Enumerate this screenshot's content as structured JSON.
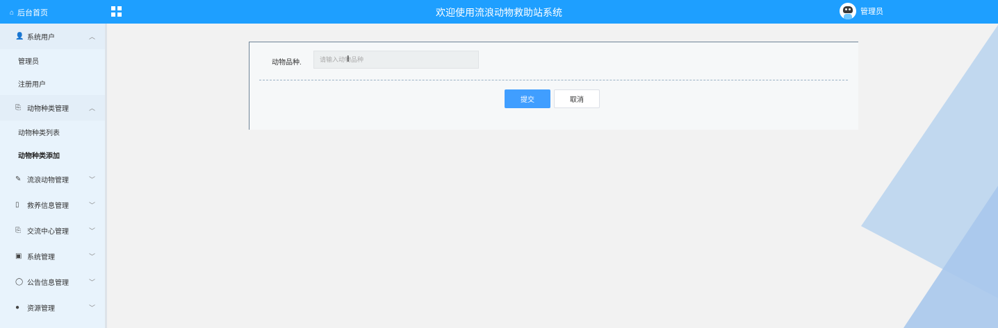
{
  "topbar": {
    "home_label": "后台首页",
    "title": "欢迎使用流浪动物救助站系统",
    "username": "管理员"
  },
  "sidebar": {
    "groups": [
      {
        "label": "系统用户",
        "icon": "user-icon",
        "expanded": true,
        "children": [
          {
            "label": "管理员"
          },
          {
            "label": "注册用户"
          }
        ]
      },
      {
        "label": "动物种类管理",
        "icon": "folder-icon",
        "expanded": true,
        "children": [
          {
            "label": "动物种类列表"
          },
          {
            "label": "动物种类添加",
            "active": true
          }
        ]
      },
      {
        "label": "流浪动物管理",
        "icon": "edit-icon",
        "expanded": false
      },
      {
        "label": "救养信息管理",
        "icon": "document-icon",
        "expanded": false
      },
      {
        "label": "交流中心管理",
        "icon": "folder-icon",
        "expanded": false
      },
      {
        "label": "系统管理",
        "icon": "image-icon",
        "expanded": false
      },
      {
        "label": "公告信息管理",
        "icon": "circle-icon",
        "expanded": false
      },
      {
        "label": "资源管理",
        "icon": "bulb-icon",
        "expanded": false
      }
    ]
  },
  "form": {
    "field_label": "动物品种.",
    "field_placeholder": "请输入动物品种",
    "field_value": "",
    "submit_label": "提交",
    "cancel_label": "取消"
  },
  "colors": {
    "topbar": "#1e9fff",
    "sidebar_bg": "#e8f3fc",
    "primary_button": "#409eff",
    "page_bg": "#f2f2f2"
  }
}
